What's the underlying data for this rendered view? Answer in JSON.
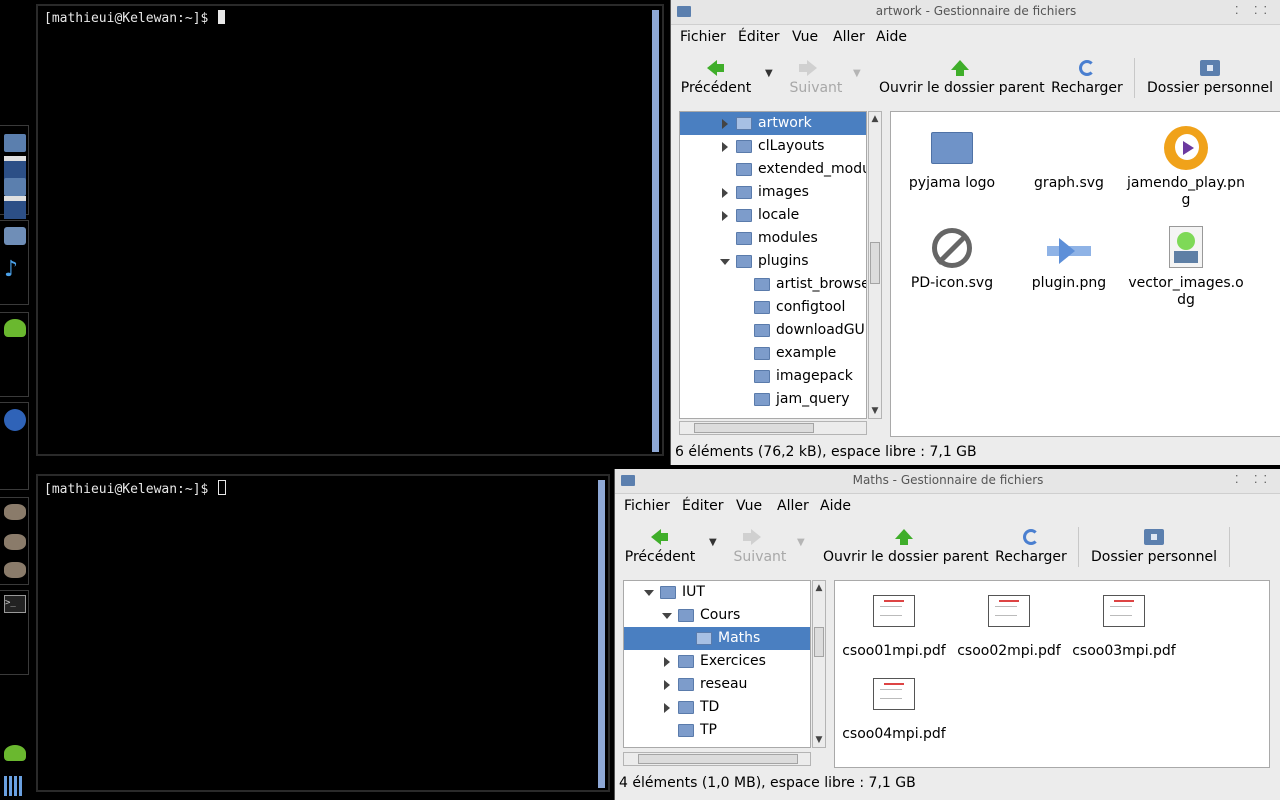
{
  "terminals": {
    "top": {
      "prompt": "[mathieui@Kelewan:~]$ "
    },
    "bottom": {
      "prompt": "[mathieui@Kelewan:~]$ "
    }
  },
  "dock": {
    "icons": [
      "folder-icon",
      "window-icon",
      "folder-icon",
      "window-icon",
      "media-player-icon",
      "music-note-icon",
      "user-icon",
      "globe-icon",
      "gimp-icon",
      "gimp-icon",
      "gimp-icon",
      "terminal-icon",
      "user-status-icon",
      "signal-icon"
    ]
  },
  "menu": {
    "file": "Fichier",
    "edit": "Éditer",
    "view": "Vue",
    "go": "Aller",
    "help": "Aide"
  },
  "toolbar": {
    "back": "Précédent",
    "forward": "Suivant",
    "parent": "Ouvrir le dossier parent",
    "reload": "Recharger",
    "home": "Dossier personnel"
  },
  "fm_top": {
    "title": "artwork - Gestionnaire de fichiers",
    "tree": [
      {
        "label": "artwork",
        "expander": "closed",
        "level": 0,
        "selected": true
      },
      {
        "label": "clLayouts",
        "expander": "closed",
        "level": 0
      },
      {
        "label": "extended_modules",
        "expander": "none",
        "level": 0
      },
      {
        "label": "images",
        "expander": "closed",
        "level": 0
      },
      {
        "label": "locale",
        "expander": "closed",
        "level": 0
      },
      {
        "label": "modules",
        "expander": "none",
        "level": 0
      },
      {
        "label": "plugins",
        "expander": "open",
        "level": 0
      },
      {
        "label": "artist_browser",
        "expander": "none",
        "level": 1
      },
      {
        "label": "configtool",
        "expander": "none",
        "level": 1
      },
      {
        "label": "downloadGUI",
        "expander": "none",
        "level": 1
      },
      {
        "label": "example",
        "expander": "none",
        "level": 1
      },
      {
        "label": "imagepack",
        "expander": "none",
        "level": 1
      },
      {
        "label": "jam_query",
        "expander": "none",
        "level": 1
      }
    ],
    "files": [
      {
        "name": "pyjama logo",
        "icon": "folder-icon"
      },
      {
        "name": "graph.svg",
        "icon": "blank-icon"
      },
      {
        "name": "jamendo_play.png",
        "icon": "play-icon"
      },
      {
        "name": "PD-icon.svg",
        "icon": "public-domain-icon"
      },
      {
        "name": "plugin.png",
        "icon": "plug-icon"
      },
      {
        "name": "vector_images.odg",
        "icon": "drawing-icon"
      }
    ],
    "status": "6 éléments (76,2 kB), espace libre : 7,1 GB"
  },
  "fm_bottom": {
    "title": "Maths - Gestionnaire de fichiers",
    "tree": [
      {
        "label": "IUT",
        "expander": "open",
        "level": 0
      },
      {
        "label": "Cours",
        "expander": "open",
        "level": 1
      },
      {
        "label": "Maths",
        "expander": "none",
        "level": 2,
        "selected": true
      },
      {
        "label": "Exercices",
        "expander": "closed",
        "level": 1
      },
      {
        "label": "reseau",
        "expander": "closed",
        "level": 1
      },
      {
        "label": "TD",
        "expander": "closed",
        "level": 1
      },
      {
        "label": "TP",
        "expander": "none",
        "level": 1
      }
    ],
    "files": [
      {
        "name": "csoo01mpi.pdf",
        "icon": "pdf-icon"
      },
      {
        "name": "csoo02mpi.pdf",
        "icon": "pdf-icon"
      },
      {
        "name": "csoo03mpi.pdf",
        "icon": "pdf-icon"
      },
      {
        "name": "csoo04mpi.pdf",
        "icon": "pdf-icon"
      }
    ],
    "status": "4 éléments (1,0 MB), espace libre : 7,1 GB"
  }
}
